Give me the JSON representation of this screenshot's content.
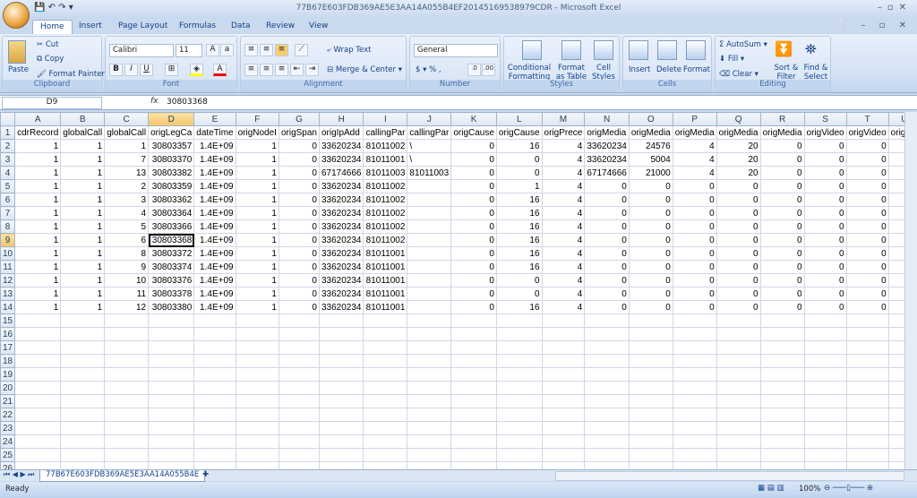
{
  "window": {
    "title": "77B67E603FDB369AE5E3AA14A055B4EF20145169538979CDR - Microsoft Excel"
  },
  "tabs": [
    "Home",
    "Insert",
    "Page Layout",
    "Formulas",
    "Data",
    "Review",
    "View"
  ],
  "ribbon": {
    "clipboard": {
      "label": "Clipboard",
      "paste": "Paste",
      "cut": "Cut",
      "copy": "Copy",
      "format_painter": "Format Painter"
    },
    "font": {
      "label": "Font",
      "name": "Calibri",
      "size": "11"
    },
    "alignment": {
      "label": "Alignment",
      "wrap": "Wrap Text",
      "merge": "Merge & Center"
    },
    "number": {
      "label": "Number",
      "format": "General"
    },
    "styles": {
      "label": "Styles",
      "conditional": "Conditional Formatting",
      "format_table": "Format as Table",
      "cell_styles": "Cell Styles"
    },
    "cells": {
      "label": "Cells",
      "insert": "Insert",
      "delete": "Delete",
      "format": "Format"
    },
    "editing": {
      "label": "Editing",
      "autosum": "AutoSum",
      "fill": "Fill",
      "clear": "Clear",
      "sort": "Sort & Filter",
      "find": "Find & Select"
    }
  },
  "formula_bar": {
    "name_box": "D9",
    "fx": "fx",
    "value": "30803368"
  },
  "sheet": {
    "columns": [
      "A",
      "B",
      "C",
      "D",
      "E",
      "F",
      "G",
      "H",
      "I",
      "J",
      "K",
      "L",
      "M",
      "N",
      "O",
      "P",
      "Q",
      "R",
      "S",
      "T",
      "U"
    ],
    "selected_cell": "D9",
    "rows": [
      [
        "cdrRecord",
        "globalCall",
        "globalCall",
        "origLegCa",
        "dateTime",
        "origNodeI",
        "origSpan",
        "origIpAdd",
        "callingPar",
        "callingPar",
        "origCause",
        "origCause",
        "origPrece",
        "origMedia",
        "origMedia",
        "origMedia",
        "origMedia",
        "origMedia",
        "origVideo",
        "origVideo",
        "origVic"
      ],
      [
        "1",
        "1",
        "1",
        "30803357",
        "1.4E+09",
        "1",
        "0",
        "33620234",
        "81011002",
        "\\",
        "0",
        "16",
        "4",
        "33620234",
        "24576",
        "4",
        "20",
        "0",
        "0",
        "0",
        ""
      ],
      [
        "1",
        "1",
        "7",
        "30803370",
        "1.4E+09",
        "1",
        "0",
        "33620234",
        "81011001",
        "\\",
        "0",
        "0",
        "4",
        "33620234",
        "5004",
        "4",
        "20",
        "0",
        "0",
        "0",
        ""
      ],
      [
        "1",
        "1",
        "13",
        "30803382",
        "1.4E+09",
        "1",
        "0",
        "67174666",
        "81011003",
        "81011003",
        "0",
        "0",
        "4",
        "67174666",
        "21000",
        "4",
        "20",
        "0",
        "0",
        "0",
        ""
      ],
      [
        "1",
        "1",
        "2",
        "30803359",
        "1.4E+09",
        "1",
        "0",
        "33620234",
        "81011002",
        "",
        "0",
        "1",
        "4",
        "0",
        "0",
        "0",
        "0",
        "0",
        "0",
        "0",
        ""
      ],
      [
        "1",
        "1",
        "3",
        "30803362",
        "1.4E+09",
        "1",
        "0",
        "33620234",
        "81011002",
        "",
        "0",
        "16",
        "4",
        "0",
        "0",
        "0",
        "0",
        "0",
        "0",
        "0",
        ""
      ],
      [
        "1",
        "1",
        "4",
        "30803364",
        "1.4E+09",
        "1",
        "0",
        "33620234",
        "81011002",
        "",
        "0",
        "16",
        "4",
        "0",
        "0",
        "0",
        "0",
        "0",
        "0",
        "0",
        ""
      ],
      [
        "1",
        "1",
        "5",
        "30803366",
        "1.4E+09",
        "1",
        "0",
        "33620234",
        "81011002",
        "",
        "0",
        "16",
        "4",
        "0",
        "0",
        "0",
        "0",
        "0",
        "0",
        "0",
        ""
      ],
      [
        "1",
        "1",
        "6",
        "30803368",
        "1.4E+09",
        "1",
        "0",
        "33620234",
        "81011002",
        "",
        "0",
        "16",
        "4",
        "0",
        "0",
        "0",
        "0",
        "0",
        "0",
        "0",
        ""
      ],
      [
        "1",
        "1",
        "8",
        "30803372",
        "1.4E+09",
        "1",
        "0",
        "33620234",
        "81011001",
        "",
        "0",
        "16",
        "4",
        "0",
        "0",
        "0",
        "0",
        "0",
        "0",
        "0",
        ""
      ],
      [
        "1",
        "1",
        "9",
        "30803374",
        "1.4E+09",
        "1",
        "0",
        "33620234",
        "81011001",
        "",
        "0",
        "16",
        "4",
        "0",
        "0",
        "0",
        "0",
        "0",
        "0",
        "0",
        ""
      ],
      [
        "1",
        "1",
        "10",
        "30803376",
        "1.4E+09",
        "1",
        "0",
        "33620234",
        "81011001",
        "",
        "0",
        "0",
        "4",
        "0",
        "0",
        "0",
        "0",
        "0",
        "0",
        "0",
        ""
      ],
      [
        "1",
        "1",
        "11",
        "30803378",
        "1.4E+09",
        "1",
        "0",
        "33620234",
        "81011001",
        "",
        "0",
        "0",
        "4",
        "0",
        "0",
        "0",
        "0",
        "0",
        "0",
        "0",
        ""
      ],
      [
        "1",
        "1",
        "12",
        "30803380",
        "1.4E+09",
        "1",
        "0",
        "33620234",
        "81011001",
        "",
        "0",
        "16",
        "4",
        "0",
        "0",
        "0",
        "0",
        "0",
        "0",
        "0",
        ""
      ]
    ],
    "visible_row_count": 26,
    "tab_name": "77B67E603FDB369AE5E3AA14A055B4E"
  },
  "status": {
    "text": "Ready",
    "zoom": "100%"
  }
}
